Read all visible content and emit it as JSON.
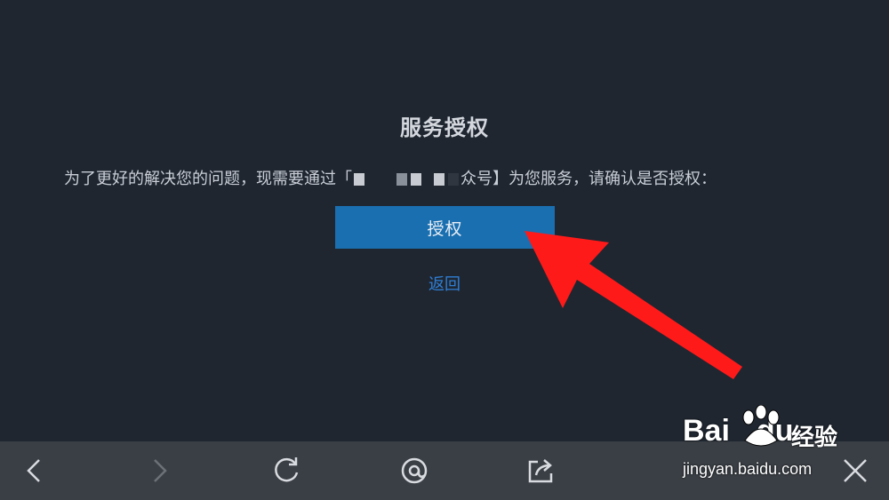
{
  "dialog": {
    "title": "服务授权",
    "message_prefix": "为了更好的解决您的问题，现需要通过「",
    "message_suffix": "众号】为您服务，请确认是否授权：",
    "authorize_label": "授权",
    "back_label": "返回"
  },
  "toolbar": {
    "icons": [
      "back-icon",
      "forward-icon",
      "refresh-icon",
      "at-icon",
      "share-icon",
      "close-icon"
    ]
  },
  "watermark": {
    "brand": "Bai",
    "brand_suffix": "du",
    "product": "经验",
    "url": "jingyan.baidu.com"
  },
  "colors": {
    "background": "#1f2630",
    "button": "#1a6fb0",
    "link": "#2f7fd6",
    "toolbar": "#3a3f45",
    "annotation_arrow": "#ff1a1a"
  }
}
